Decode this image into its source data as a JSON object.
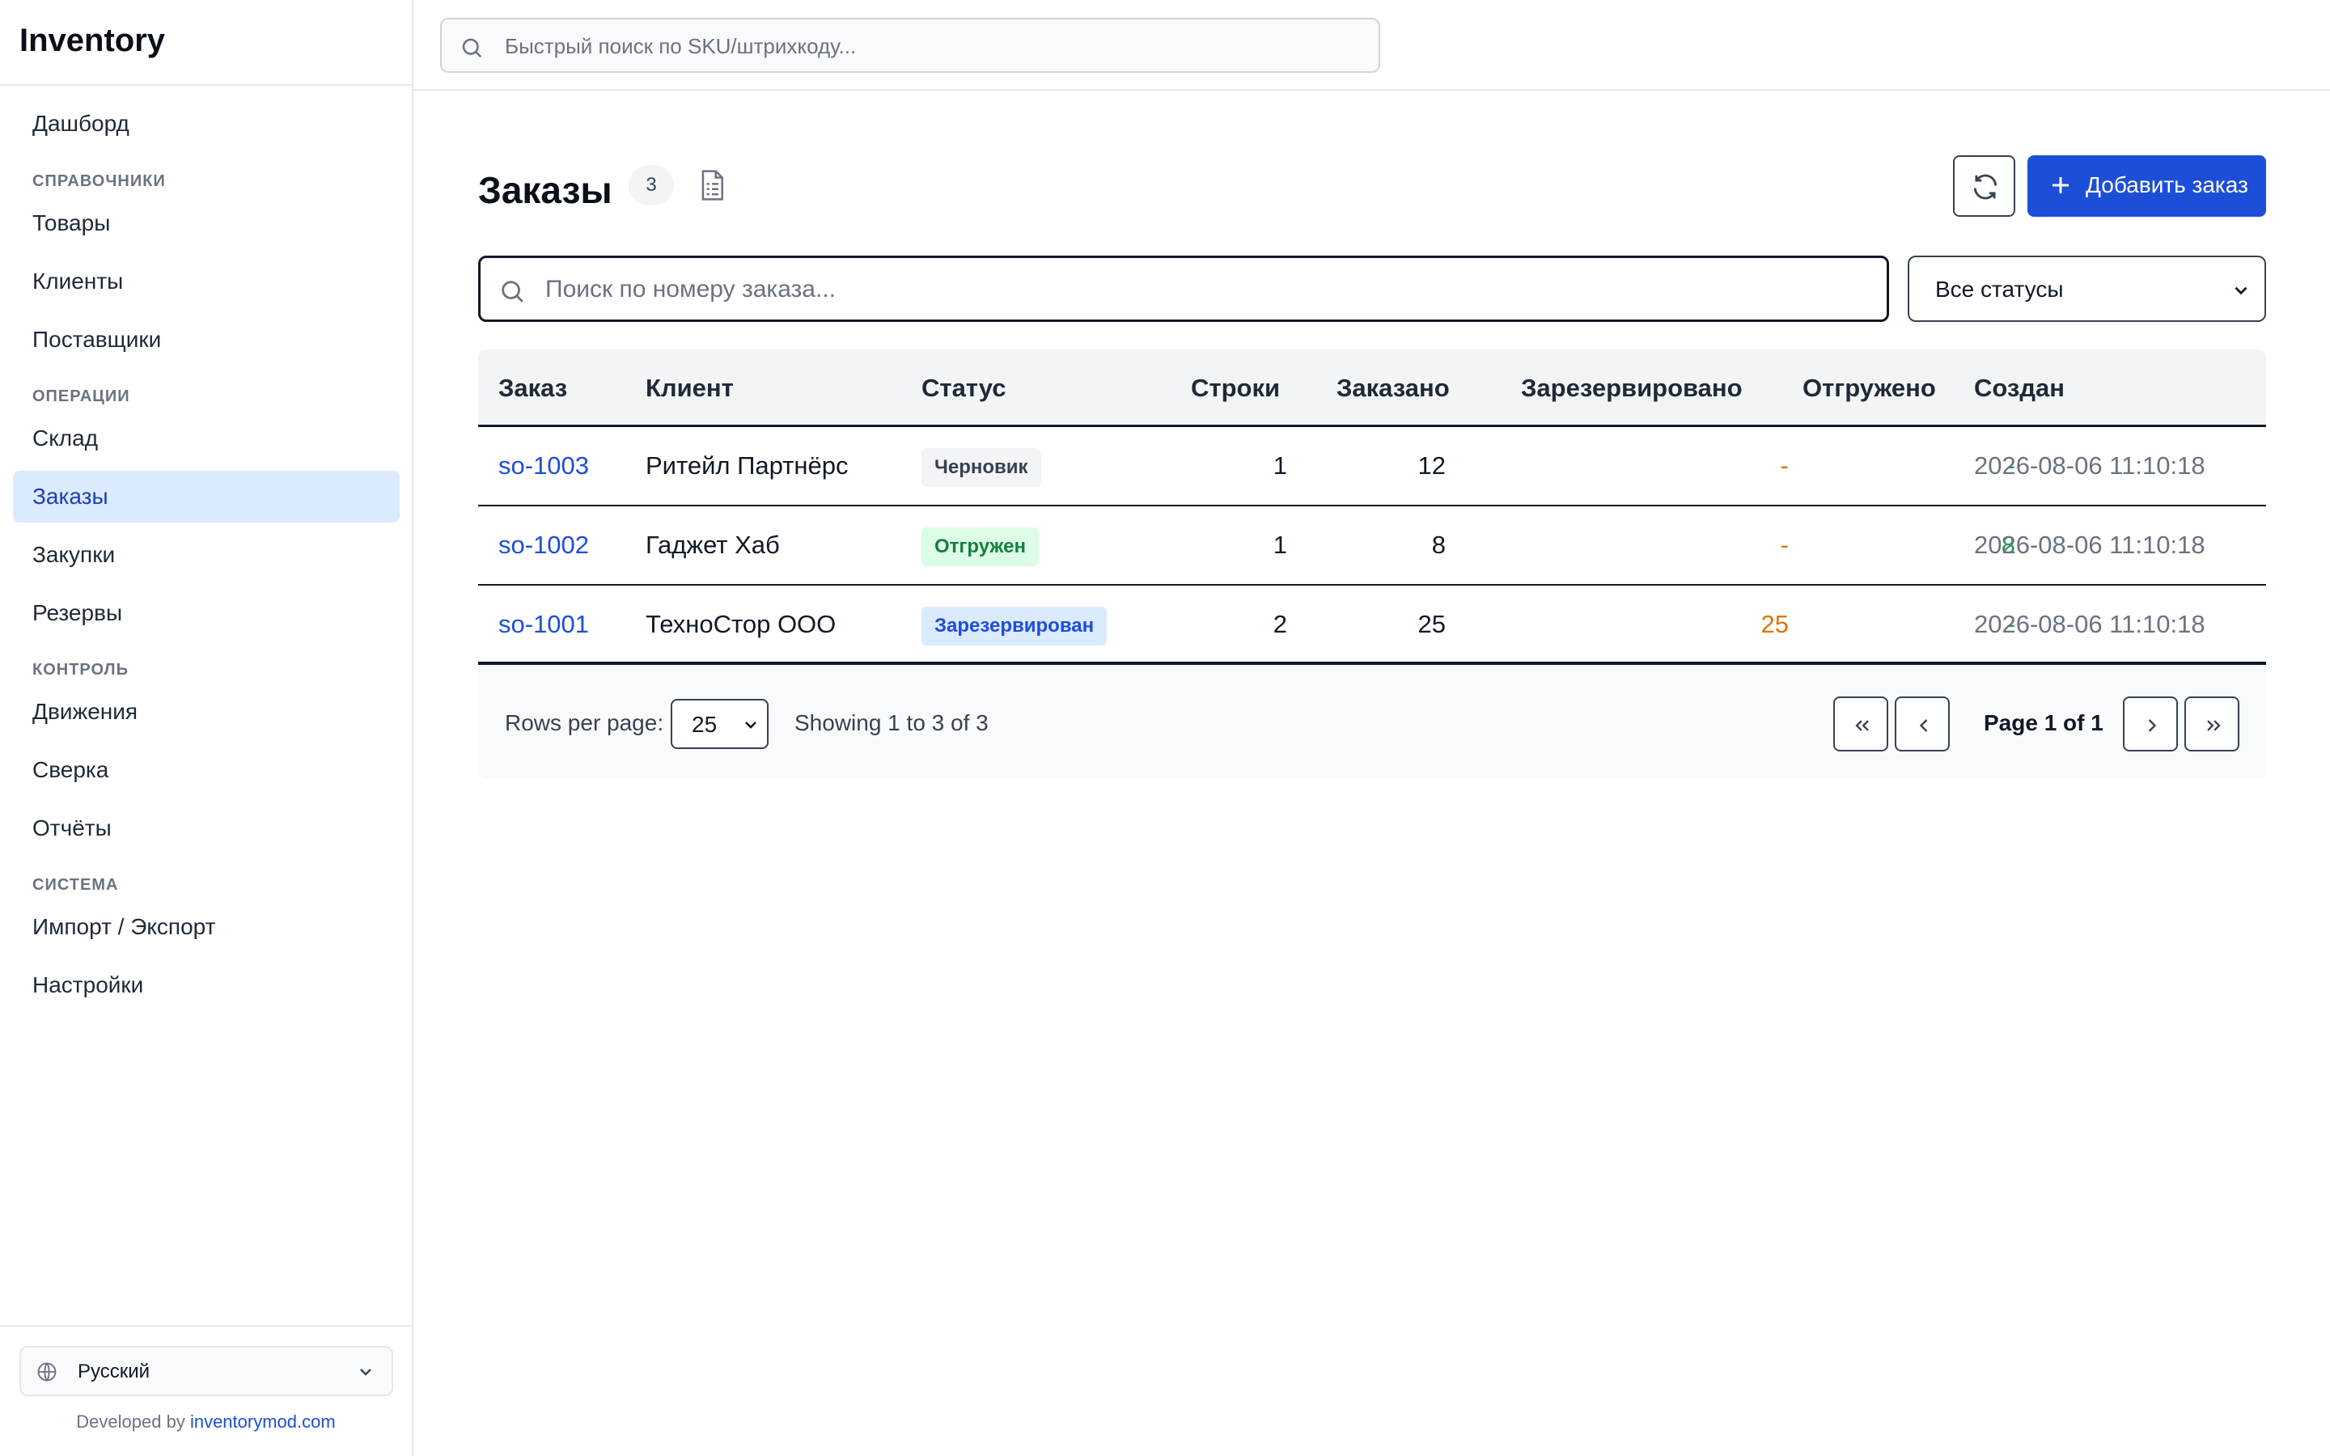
{
  "app": {
    "brand": "Inventory"
  },
  "sidebar": {
    "items": [
      {
        "label": "Дашборд"
      },
      {
        "section": "СПРАВОЧНИКИ"
      },
      {
        "label": "Товары"
      },
      {
        "label": "Клиенты"
      },
      {
        "label": "Поставщики"
      },
      {
        "section": "ОПЕРАЦИИ"
      },
      {
        "label": "Склад"
      },
      {
        "label": "Заказы",
        "active": true
      },
      {
        "label": "Закупки"
      },
      {
        "label": "Резервы"
      },
      {
        "section": "КОНТРОЛЬ"
      },
      {
        "label": "Движения"
      },
      {
        "label": "Сверка"
      },
      {
        "label": "Отчёты"
      },
      {
        "section": "СИСТЕМА"
      },
      {
        "label": "Импорт / Экспорт"
      },
      {
        "label": "Настройки"
      }
    ],
    "language": {
      "label": "Русский",
      "icon": "globe-icon"
    },
    "developed_by": {
      "prefix": "Developed by ",
      "link": "inventorymod.com"
    }
  },
  "topbar": {
    "quick_search": {
      "placeholder": "Быстрый поиск по SKU/штрихкоду...",
      "icon": "search-icon"
    }
  },
  "main": {
    "title": "Заказы",
    "count": "3",
    "add_button": "Добавить заказ",
    "search": {
      "placeholder": "Поиск по номеру заказа..."
    },
    "status_filter": {
      "selected": "Все статусы"
    },
    "accent_color": "#1d4ed8",
    "table": {
      "columns": [
        "Заказ",
        "Клиент",
        "Статус",
        "Строки",
        "Заказано",
        "Зарезервировано",
        "Отгружено",
        "Создан"
      ],
      "rows": [
        {
          "order": "so-1003",
          "client": "Ритейл Партнёрс",
          "status": "Черновик",
          "status_kind": "draft",
          "lines": "1",
          "ordered": "12",
          "reserved": "-",
          "shipped": "-",
          "created": "2026-08-06 11:10:18"
        },
        {
          "order": "so-1002",
          "client": "Гаджет Хаб",
          "status": "Отгружен",
          "status_kind": "shipped",
          "lines": "1",
          "ordered": "8",
          "reserved": "-",
          "shipped": "8",
          "created": "2026-08-06 11:10:18"
        },
        {
          "order": "so-1001",
          "client": "ТехноСтор ООО",
          "status": "Зарезервирован",
          "status_kind": "reserved",
          "lines": "2",
          "ordered": "25",
          "reserved": "25",
          "shipped": "-",
          "created": "2026-08-06 11:10:18"
        }
      ]
    },
    "pagination": {
      "rows_per_page_label": "Rows per page:",
      "rows_per_page": "25",
      "showing": "Showing 1 to 3 of 3",
      "page_label": "Page 1 of 1"
    }
  }
}
